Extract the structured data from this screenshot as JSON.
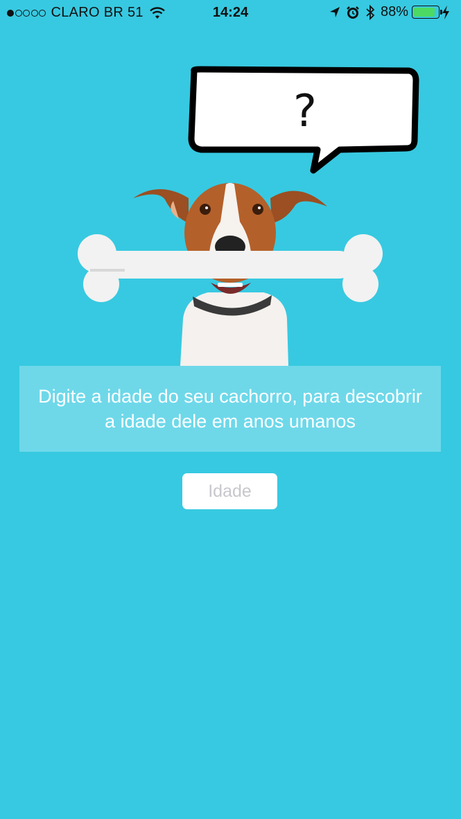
{
  "status_bar": {
    "signal_bars_filled": 1,
    "signal_bars_total": 5,
    "carrier": "CLARO BR 51",
    "time": "14:24",
    "battery_percent": "88%",
    "battery_level": 0.88,
    "icons": [
      "wifi-icon",
      "location-arrow-icon",
      "alarm-icon",
      "bluetooth-icon",
      "battery-icon",
      "charging-bolt-icon"
    ]
  },
  "illustration": {
    "bubble_text": "?"
  },
  "main": {
    "instruction": "Digite a idade do seu cachorro, para descobrir a idade dele em anos umanos",
    "age_input_placeholder": "Idade",
    "age_input_value": ""
  },
  "colors": {
    "background": "#37c9e1",
    "battery_fill": "#4cd964"
  }
}
